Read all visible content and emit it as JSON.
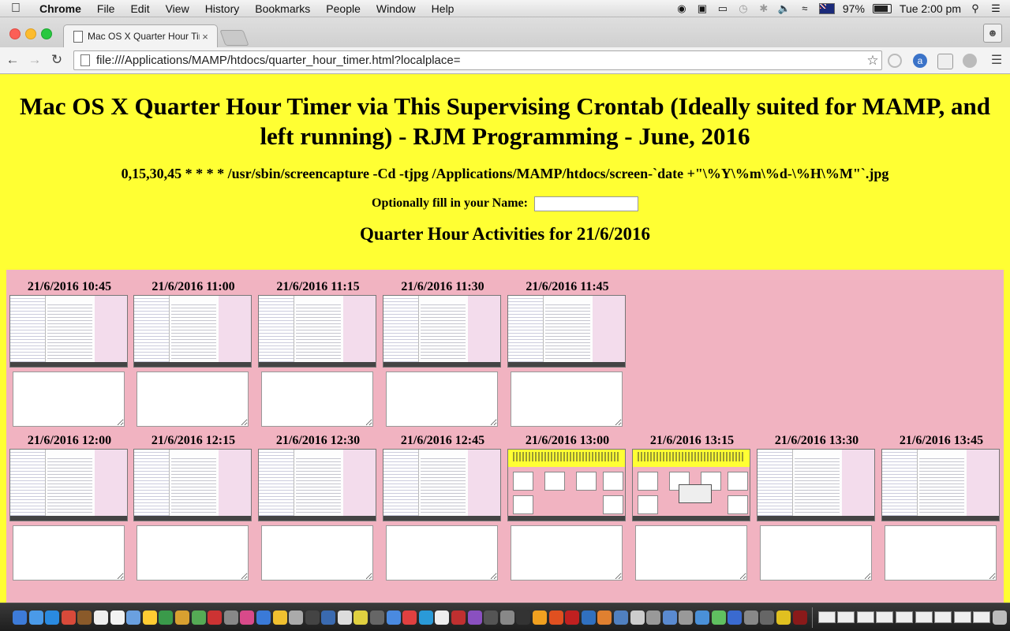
{
  "menubar": {
    "app": "Chrome",
    "items": [
      "File",
      "Edit",
      "View",
      "History",
      "Bookmarks",
      "People",
      "Window",
      "Help"
    ],
    "battery": "97%",
    "clock": "Tue 2:00 pm"
  },
  "tab": {
    "title": "Mac OS X Quarter Hour Tir",
    "close": "×"
  },
  "address": {
    "url": "file:///Applications/MAMP/htdocs/quarter_hour_timer.html?localplace="
  },
  "page": {
    "title": "Mac OS X Quarter Hour Timer via This Supervising Crontab (Ideally suited for MAMP, and left running) - RJM Programming - June, 2016",
    "cron": "0,15,30,45 * * * * /usr/sbin/screencapture -Cd -tjpg /Applications/MAMP/htdocs/screen-`date +\"\\%Y\\%m\\%d-\\%H\\%M\"`.jpg",
    "name_label": "Optionally fill in your Name:",
    "name_value": "",
    "activities_heading": "Quarter Hour Activities for 21/6/2016",
    "row1": [
      "21/6/2016 10:45",
      "21/6/2016 11:00",
      "21/6/2016 11:15",
      "21/6/2016 11:30",
      "21/6/2016 11:45"
    ],
    "row2": [
      "21/6/2016 12:00",
      "21/6/2016 12:15",
      "21/6/2016 12:30",
      "21/6/2016 12:45",
      "21/6/2016 13:00",
      "21/6/2016 13:15",
      "21/6/2016 13:30",
      "21/6/2016 13:45"
    ]
  }
}
